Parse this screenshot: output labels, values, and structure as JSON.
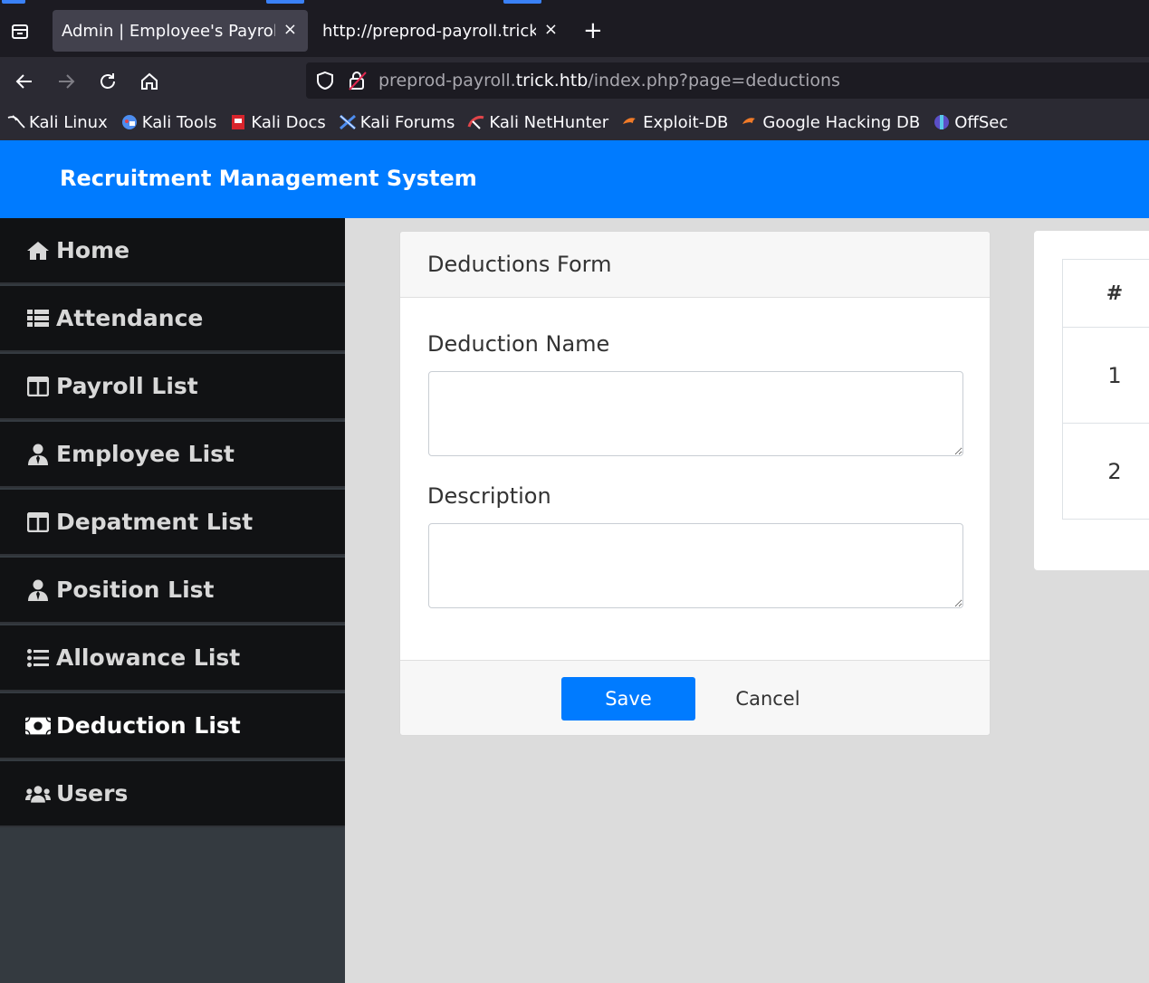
{
  "browser": {
    "tabs": [
      {
        "title": "Admin | Employee's Payroll Management System",
        "close": "×"
      },
      {
        "title": "http://preprod-payroll.trick.htb/index.php?page=deductions",
        "close": "×"
      }
    ],
    "new_tab": "+",
    "url": {
      "prefix": "preprod-payroll.",
      "domain": "trick.htb",
      "path": "/index.php?page=deductions"
    },
    "nav_icons": [
      "back-arrow-icon",
      "forward-arrow-icon",
      "reload-icon",
      "home-icon"
    ],
    "bookmarks": [
      {
        "label": "Kali Linux",
        "icon": "kali-dragon-icon"
      },
      {
        "label": "Kali Tools",
        "icon": "kali-tools-icon"
      },
      {
        "label": "Kali Docs",
        "icon": "kali-docs-icon"
      },
      {
        "label": "Kali Forums",
        "icon": "kali-forums-icon"
      },
      {
        "label": "Kali NetHunter",
        "icon": "nethunter-icon"
      },
      {
        "label": "Exploit-DB",
        "icon": "exploit-db-icon"
      },
      {
        "label": "Google Hacking DB",
        "icon": "ghdb-icon"
      },
      {
        "label": "OffSec",
        "icon": "offsec-icon"
      }
    ]
  },
  "app": {
    "title": "Recruitment Management System",
    "accent_color": "#007bff"
  },
  "sidebar": {
    "items": [
      {
        "label": "Home",
        "icon": "home-icon"
      },
      {
        "label": "Attendance",
        "icon": "table-list-icon"
      },
      {
        "label": "Payroll List",
        "icon": "columns-icon"
      },
      {
        "label": "Employee List",
        "icon": "user-tie-icon"
      },
      {
        "label": "Depatment List",
        "icon": "columns-icon"
      },
      {
        "label": "Position List",
        "icon": "user-tie-icon"
      },
      {
        "label": "Allowance List",
        "icon": "list-icon"
      },
      {
        "label": "Deduction List",
        "icon": "money-bill-icon",
        "active": true
      },
      {
        "label": "Users",
        "icon": "users-icon"
      }
    ]
  },
  "form": {
    "header": "Deductions Form",
    "deduction_name_label": "Deduction Name",
    "deduction_name_value": "",
    "description_label": "Description",
    "description_value": "",
    "save_label": "Save",
    "cancel_label": "Cancel"
  },
  "table": {
    "header": "#",
    "rows": [
      "1",
      "2"
    ]
  }
}
